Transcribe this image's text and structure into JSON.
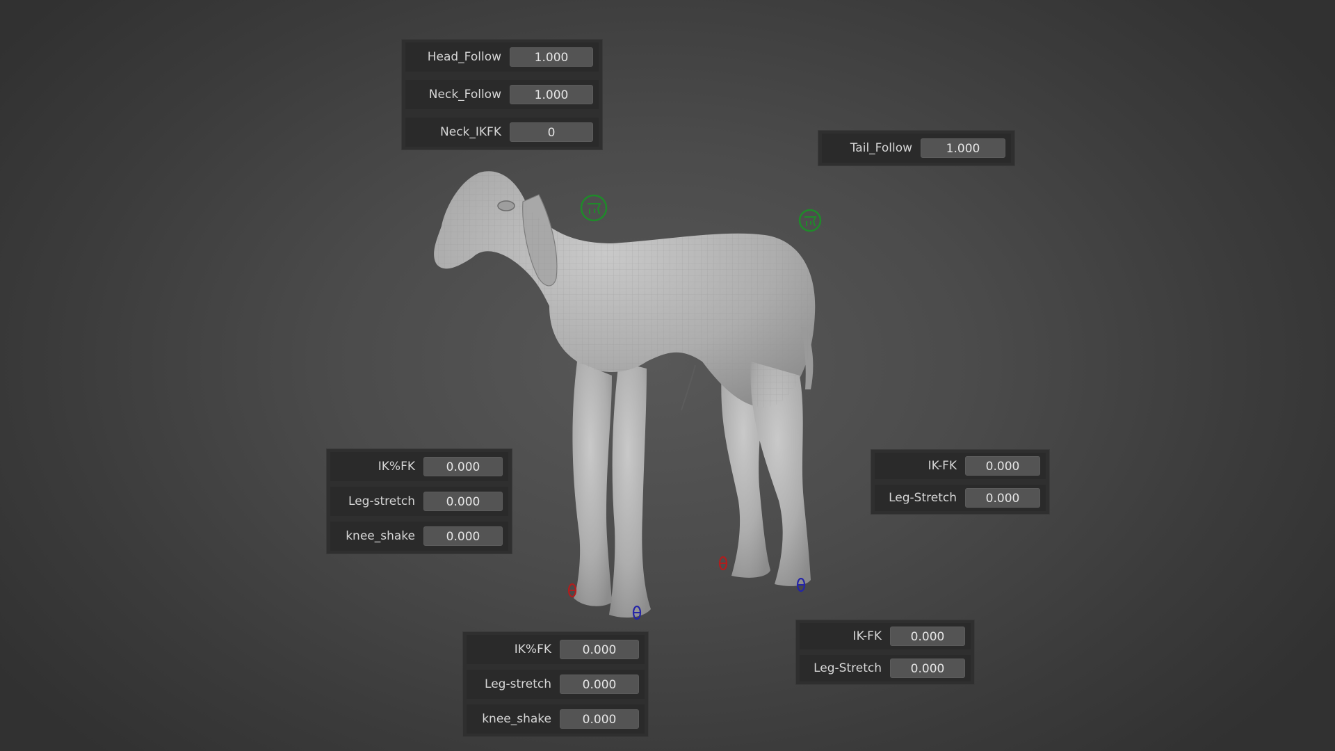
{
  "head_panel": {
    "rows": [
      {
        "label": "Head_Follow",
        "value": "1.000"
      },
      {
        "label": "Neck_Follow",
        "value": "1.000"
      },
      {
        "label": "Neck_IKFK",
        "value": "0"
      }
    ]
  },
  "tail_panel": {
    "rows": [
      {
        "label": "Tail_Follow",
        "value": "1.000"
      }
    ]
  },
  "front_left_leg_panel": {
    "rows": [
      {
        "label": "IK%FK",
        "value": "0.000"
      },
      {
        "label": "Leg-stretch",
        "value": "0.000"
      },
      {
        "label": "knee_shake",
        "value": "0.000"
      }
    ]
  },
  "front_right_leg_panel": {
    "rows": [
      {
        "label": "IK%FK",
        "value": "0.000"
      },
      {
        "label": "Leg-stretch",
        "value": "0.000"
      },
      {
        "label": "knee_shake",
        "value": "0.000"
      }
    ]
  },
  "back_upper_leg_panel": {
    "rows": [
      {
        "label": "IK-FK",
        "value": "0.000"
      },
      {
        "label": "Leg-Stretch",
        "value": "0.000"
      }
    ]
  },
  "back_lower_leg_panel": {
    "rows": [
      {
        "label": "IK-FK",
        "value": "0.000"
      },
      {
        "label": "Leg-Stretch",
        "value": "0.000"
      }
    ]
  },
  "colors": {
    "panel_bg": "#2f2f2f",
    "row_bg": "#2a2a2a",
    "field_bg": "#545454",
    "mesh": "#b4b4b4",
    "control_green": "#1f8a2a",
    "control_red": "#b11d1d",
    "control_blue": "#2424a8"
  },
  "icons": [
    "head-control-icon",
    "tail-control-icon",
    "foot-ik-control-icon"
  ]
}
